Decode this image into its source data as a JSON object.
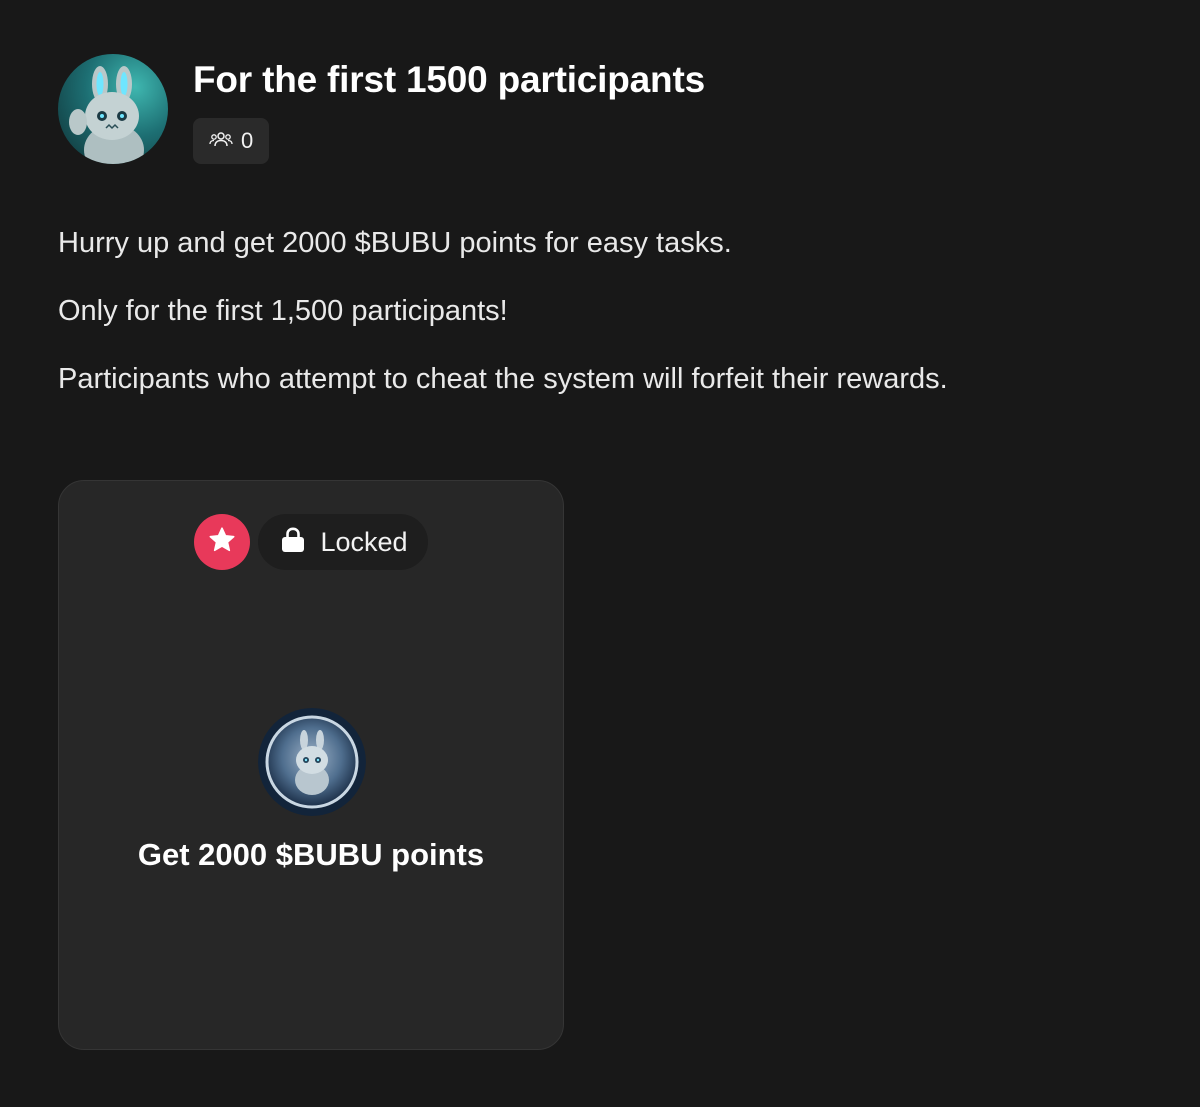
{
  "campaign": {
    "title": "For the first 1500 participants",
    "participants_count": "0",
    "participants_icon": "users-icon",
    "avatar": "bunny-mascot-avatar"
  },
  "description": {
    "lines": [
      "Hurry up and get 2000 $BUBU points for easy tasks.",
      "Only for the first 1,500 participants!",
      "Participants who attempt to cheat the system will forfeit their rewards."
    ]
  },
  "reward_card": {
    "status_label": "Locked",
    "status_icon": "lock-icon",
    "badge_icon": "star-icon",
    "badge_color": "#e8395a",
    "coin_icon": "bubu-coin-icon",
    "title": "Get 2000 $BUBU points"
  },
  "colors": {
    "background": "#181818",
    "card_background": "#272727",
    "badge_background": "#2a2a2a",
    "accent": "#e8395a"
  }
}
